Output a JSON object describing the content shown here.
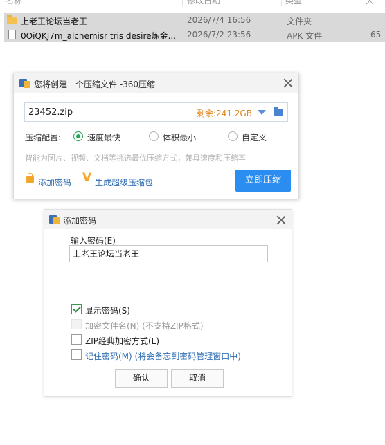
{
  "explorer": {
    "columns": {
      "name": "名称",
      "date": "修改日期",
      "type": "类型",
      "size": "大"
    },
    "files": [
      {
        "name": "上老王论坛当老王",
        "date": "2026/7/4 16:56",
        "type": "文件夹",
        "size": "",
        "icon": "folder-icon"
      },
      {
        "name": "0OiQKJ7m_alchemisr tris desire炼金...",
        "date": "2026/7/2 23:56",
        "type": "APK 文件",
        "size": "65",
        "icon": "document-icon"
      }
    ]
  },
  "compress_dialog": {
    "title": "您将创建一个压缩文件 -360压缩",
    "filename": "23452.zip",
    "free_space": "剩余:241.2GB",
    "config_label": "压缩配置:",
    "options": [
      {
        "label": "速度最快",
        "selected": true
      },
      {
        "label": "体积最小",
        "selected": false
      },
      {
        "label": "自定义",
        "selected": false
      }
    ],
    "hint": "智能为图片、视频、文档等挑选最优压缩方式，兼具速度和压缩率",
    "add_password_link": "添加密码",
    "super_pack_link": "生成超级压缩包",
    "compress_button": "立即压缩",
    "accent_color": "#2c8df0"
  },
  "password_dialog": {
    "title": "添加密码",
    "input_label": "输入密码(E)",
    "password_value": "上老王论坛当老王",
    "checkboxes": [
      {
        "label": "显示密码(S)",
        "checked": true,
        "enabled": true
      },
      {
        "label": "加密文件名(N) (不支持ZIP格式)",
        "checked": false,
        "enabled": false
      },
      {
        "label": "ZIP经典加密方式(L)",
        "checked": false,
        "enabled": true
      },
      {
        "label": "记住密码(M) (将会备忘到密码管理窗口中)",
        "checked": false,
        "enabled": true
      }
    ],
    "ok_button": "确认",
    "cancel_button": "取消"
  }
}
